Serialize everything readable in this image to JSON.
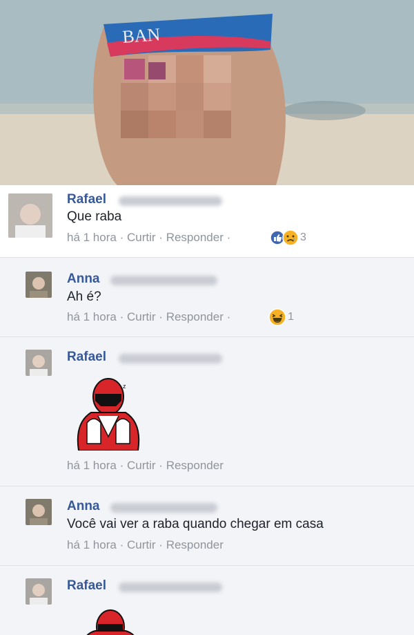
{
  "comments": [
    {
      "author": "Rafael",
      "text": "Que raba",
      "time": "há 1 hora",
      "like": "Curtir",
      "reply": "Responder",
      "sep": "·",
      "reactions": [
        "like-icon",
        "sad-icon"
      ],
      "reaction_count": "3"
    },
    {
      "author": "Anna",
      "text": "Ah é?",
      "time": "há 1 hora",
      "like": "Curtir",
      "reply": "Responder",
      "sep": "·",
      "reactions": [
        "laugh-icon"
      ],
      "reaction_count": "1"
    },
    {
      "author": "Rafael",
      "text": "",
      "time": "há 1 hora",
      "like": "Curtir",
      "reply": "Responder",
      "sep": "·",
      "sticker": "red-ranger-sticker"
    },
    {
      "author": "Anna",
      "text": "Você vai ver a raba quando chegar em casa",
      "time": "há 1 hora",
      "like": "Curtir",
      "reply": "Responder",
      "sep": "·"
    },
    {
      "author": "Rafael",
      "text": "",
      "sticker": "red-ranger-sticker"
    }
  ],
  "photo": {
    "swimsuit_text": "BAN"
  },
  "colors": {
    "name": "#365899",
    "meta": "#90949c",
    "text": "#1d2129",
    "like": "#4267b2",
    "emoji": "#f7b125",
    "ranger_red": "#d7252a"
  }
}
